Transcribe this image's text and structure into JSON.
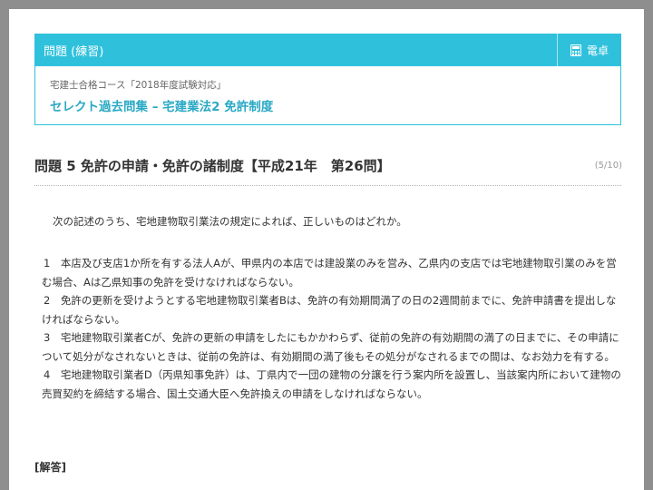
{
  "header": {
    "title": "問題 (練習)",
    "calculator_label": "電卓",
    "calculator_icon": "calculator-icon"
  },
  "course": {
    "name": "宅建士合格コース「2018年度試験対応」",
    "title": "セレクト過去問集 – 宅建業法2 免許制度"
  },
  "question": {
    "title": "問題 5 免許の申請・免許の諸制度【平成21年　第26問】",
    "progress": "(5/10)",
    "text": "次の記述のうち、宅地建物取引業法の規定によれば、正しいものはどれか。",
    "options": [
      "1　本店及び支店1か所を有する法人Aが、甲県内の本店では建設業のみを営み、乙県内の支店では宅地建物取引業のみを営む場合、Aは乙県知事の免許を受けなければならない。",
      "2　免許の更新を受けようとする宅地建物取引業者Bは、免許の有効期間満了の日の2週間前までに、免許申請書を提出しなければならない。",
      "3　宅地建物取引業者Cが、免許の更新の申請をしたにもかかわらず、従前の免許の有効期間の満了の日までに、その申請について処分がなされないときは、従前の免許は、有効期間の満了後もその処分がなされるまでの間は、なお効力を有する。",
      "4　宅地建物取引業者D（丙県知事免許）は、丁県内で一団の建物の分譲を行う案内所を設置し、当該案内所において建物の売買契約を締結する場合、国土交通大臣へ免許換えの申請をしなければならない。"
    ]
  },
  "answer": {
    "label": "[解答]"
  },
  "colors": {
    "accent": "#2fc1dc",
    "link": "#2aa9c4",
    "frame": "#8e8e8e"
  }
}
